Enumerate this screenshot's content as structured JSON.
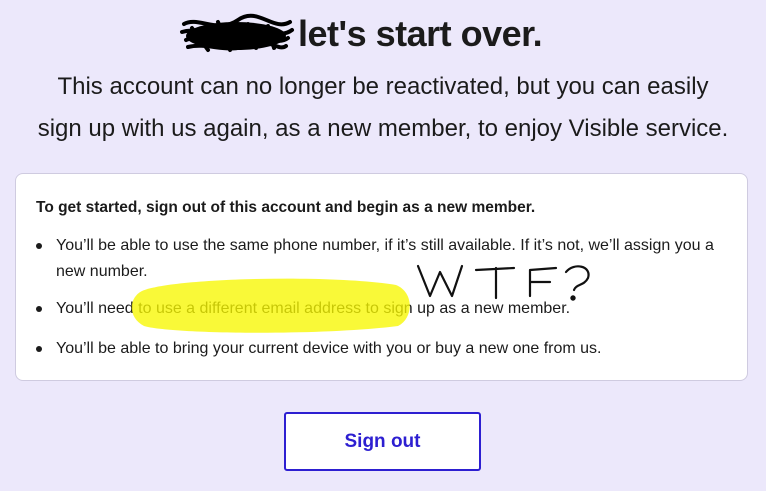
{
  "header": {
    "title": "let's start over."
  },
  "intro": {
    "line1": "This account can no longer be reactivated, but you can easily",
    "line2": "sign up with us again, as a new member, to enjoy Visible service."
  },
  "card": {
    "heading": "To get started, sign out of this account and begin as a new member.",
    "items": [
      {
        "text": "You’ll be able to use the same phone number, if it’s still available. If it’s not, we’ll assign you a new number."
      },
      {
        "text": "You’ll need to use a different email address to sign up as a new member."
      },
      {
        "text": "You’ll be able to bring your current device with you or buy a new one from us."
      }
    ]
  },
  "annotation": {
    "handwritten_text": "WTF?",
    "highlight_color": "#f7f700"
  },
  "actions": {
    "sign_out_label": "Sign out"
  },
  "colors": {
    "background": "#ece8fb",
    "accent": "#2d1fd1",
    "text": "#1b1b1b"
  }
}
